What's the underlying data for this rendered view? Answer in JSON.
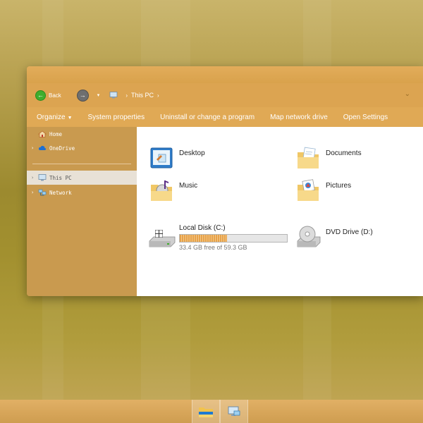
{
  "navbar": {
    "back_label": "Back",
    "recent_caret": "▾",
    "crumb_sep": "›",
    "location": "This PC"
  },
  "commandbar": {
    "organize": "Organize",
    "system_properties": "System properties",
    "uninstall": "Uninstall or change a program",
    "map_drive": "Map network drive",
    "open_settings": "Open Settings"
  },
  "sidebar": {
    "items": [
      {
        "label": "Home",
        "icon": "home-icon"
      },
      {
        "label": "OneDrive",
        "icon": "cloud-icon"
      },
      {
        "label": "This PC",
        "icon": "computer-icon",
        "selected": true
      },
      {
        "label": "Network",
        "icon": "network-icon"
      }
    ]
  },
  "folders": [
    {
      "name": "Desktop",
      "icon": "desktop-folder-icon"
    },
    {
      "name": "Documents",
      "icon": "documents-folder-icon"
    },
    {
      "name": "Music",
      "icon": "music-folder-icon"
    },
    {
      "name": "Pictures",
      "icon": "pictures-folder-icon"
    }
  ],
  "drives": [
    {
      "name": "Local Disk (C:)",
      "free_text": "33.4 GB free of 59.3 GB",
      "used_fraction": 0.44,
      "icon": "hard-disk-icon"
    },
    {
      "name": "DVD Drive (D:)",
      "icon": "dvd-drive-icon"
    }
  ],
  "colors": {
    "accent": "#dca451",
    "sidebar": "#c99a4f",
    "disk_fill": "#e7a24a"
  },
  "taskbar": {
    "items": [
      {
        "icon": "file-explorer-icon"
      },
      {
        "icon": "this-pc-icon"
      }
    ]
  }
}
